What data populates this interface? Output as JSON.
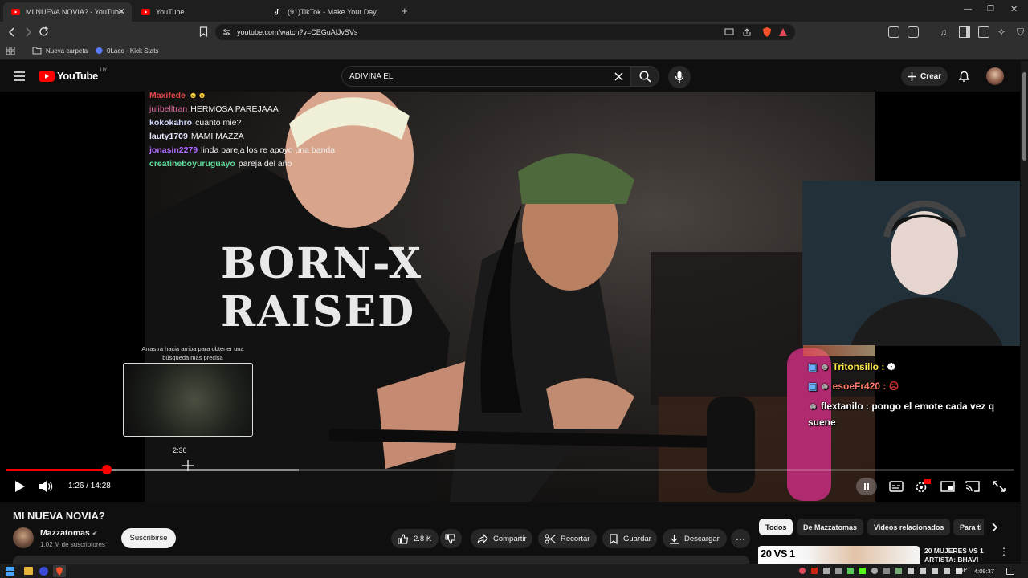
{
  "browser": {
    "tabs": [
      {
        "title": "MI NUEVA NOVIA? - YouTube",
        "active": true
      },
      {
        "title": "YouTube",
        "active": false
      },
      {
        "title": "(91)TikTok - Make Your Day",
        "active": false
      }
    ],
    "new_tab": "+",
    "url": "youtube.com/watch?v=CEGuAlJvSVs",
    "bookmarks": [
      "Nueva carpeta",
      "0Laco - Kick Stats"
    ]
  },
  "masthead": {
    "logo_text": "YouTube",
    "region": "UY",
    "search_value": "ADIVINA EL",
    "create_label": "Crear"
  },
  "video": {
    "chat": [
      {
        "user": "Maxifede",
        "msg": "",
        "color": "#e04848"
      },
      {
        "user": "julibelltran",
        "msg": "HERMOSA PAREJAAA",
        "color": "#e06c9f"
      },
      {
        "user": "kokokahro",
        "msg": "cuanto mie?",
        "color": "#d0d8ff"
      },
      {
        "user": "lauty1709",
        "msg": "MAMI MAZZA",
        "color": "#e8e8ff"
      },
      {
        "user": "jonasin2279",
        "msg": "linda pareja los re apoyo una banda",
        "color": "#b06cff"
      },
      {
        "user": "creatineboyuruguayo",
        "msg": "pareja del año",
        "color": "#5fdc9a"
      }
    ],
    "kick_chat": [
      {
        "user": "Tritonsillo :",
        "msg": "",
        "color": "#ffe84a"
      },
      {
        "user": "esoeFr420 :",
        "msg": "",
        "color": "#ff7a6a"
      },
      {
        "user": "flextanilo :",
        "msg": "pongo el emote cada vez q",
        "color": "#ffffff"
      },
      {
        "user": "",
        "msg": "suene",
        "color": "#ffffff"
      }
    ],
    "shirt_text": [
      "BORN-X",
      "RAISED"
    ],
    "preview_hint": "Arrastra hacia arriba para obtener una búsqueda más precisa",
    "preview_time": "2:36",
    "time": "1:26 / 14:28",
    "progress": {
      "played_fraction": 0.1,
      "buffered_fraction": 0.29
    }
  },
  "info": {
    "title": "MI NUEVA NOVIA?",
    "channel": "Mazzatomas",
    "subscribers": "1.02 M de suscriptores",
    "subscribe_label": "Suscribirse",
    "likes": "2.8 K",
    "share_label": "Compartir",
    "clip_label": "Recortar",
    "save_label": "Guardar",
    "download_label": "Descargar"
  },
  "chips": [
    "Todos",
    "De Mazzatomas",
    "Videos relacionados",
    "Para ti"
  ],
  "recommendation": {
    "thumb_text": "20 VS 1",
    "title": "20 MUJERES VS 1 ARTISTA: BHAVI"
  },
  "taskbar": {
    "lang": "ESP",
    "clock": "4:09:37"
  },
  "colors": {
    "accent": "#ff0000",
    "background": "#0f0f0f"
  }
}
